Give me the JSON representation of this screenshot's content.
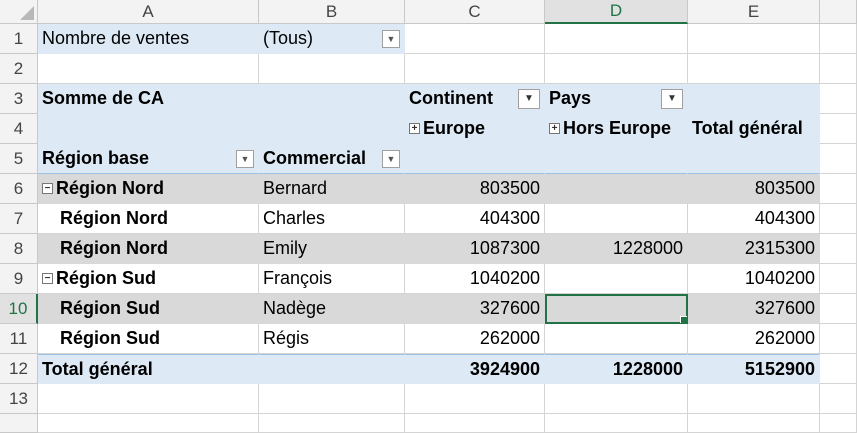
{
  "columns": [
    "A",
    "B",
    "C",
    "D",
    "E"
  ],
  "rows": [
    "1",
    "2",
    "3",
    "4",
    "5",
    "6",
    "7",
    "8",
    "9",
    "10",
    "11",
    "12",
    "13"
  ],
  "filter": {
    "label": "Nombre de ventes",
    "value": "(Tous)"
  },
  "pivot": {
    "value_header": "Somme de CA",
    "continent_label": "Continent",
    "pays_label": "Pays",
    "europe": "Europe",
    "hors_europe": "Hors Europe",
    "total_general": "Total général",
    "region_base": "Région base",
    "commercial": "Commercial",
    "body": [
      {
        "region": "Région Nord",
        "commercial": "Bernard",
        "europe": "803500",
        "hors": "",
        "total": "803500"
      },
      {
        "region": "Région Nord",
        "commercial": "Charles",
        "europe": "404300",
        "hors": "",
        "total": "404300"
      },
      {
        "region": "Région Nord",
        "commercial": "Emily",
        "europe": "1087300",
        "hors": "1228000",
        "total": "2315300"
      },
      {
        "region": "Région Sud",
        "commercial": "François",
        "europe": "1040200",
        "hors": "",
        "total": "1040200"
      },
      {
        "region": "Région Sud",
        "commercial": "Nadège",
        "europe": "327600",
        "hors": "",
        "total": "327600"
      },
      {
        "region": "Région Sud",
        "commercial": "Régis",
        "europe": "262000",
        "hors": "",
        "total": "262000"
      }
    ],
    "grand_total": {
      "label": "Total général",
      "europe": "3924900",
      "hors": "1228000",
      "total": "5152900"
    }
  },
  "colors": {
    "header_band": "#dde9f5",
    "row_band": "#d9d9d9",
    "selection": "#217346"
  }
}
